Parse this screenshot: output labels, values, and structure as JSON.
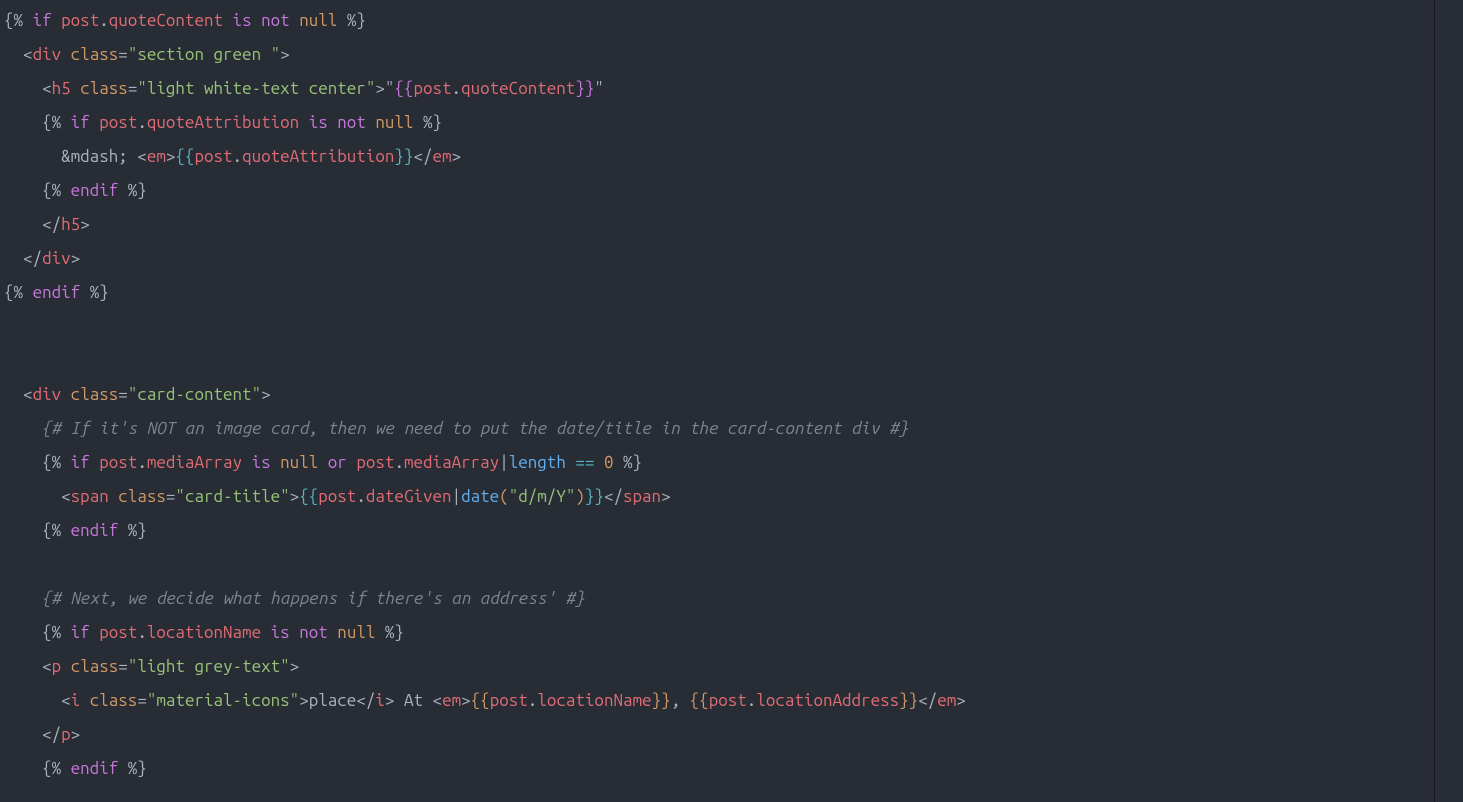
{
  "code": {
    "lines": [
      [
        {
          "t": "{% ",
          "c": "tk-delim"
        },
        {
          "t": "if",
          "c": "tk-kw"
        },
        {
          "t": " ",
          "c": "tk-delim"
        },
        {
          "t": "post",
          "c": "tk-ident"
        },
        {
          "t": ".",
          "c": "tk-punct"
        },
        {
          "t": "quoteContent",
          "c": "tk-ident"
        },
        {
          "t": " ",
          "c": "tk-delim"
        },
        {
          "t": "is",
          "c": "tk-kw"
        },
        {
          "t": " ",
          "c": "tk-delim"
        },
        {
          "t": "not",
          "c": "tk-kw"
        },
        {
          "t": " ",
          "c": "tk-delim"
        },
        {
          "t": "null",
          "c": "tk-attr"
        },
        {
          "t": " %}",
          "c": "tk-delim"
        }
      ],
      [
        {
          "t": "  ",
          "c": "tk-text"
        },
        {
          "t": "<",
          "c": "tk-punct"
        },
        {
          "t": "div",
          "c": "tk-ident"
        },
        {
          "t": " ",
          "c": "tk-text"
        },
        {
          "t": "class",
          "c": "tk-attr"
        },
        {
          "t": "=",
          "c": "tk-punct"
        },
        {
          "t": "\"section green \"",
          "c": "tk-str"
        },
        {
          "t": ">",
          "c": "tk-punct"
        }
      ],
      [
        {
          "t": "    ",
          "c": "tk-text"
        },
        {
          "t": "<",
          "c": "tk-punct"
        },
        {
          "t": "h5",
          "c": "tk-ident"
        },
        {
          "t": " ",
          "c": "tk-text"
        },
        {
          "t": "class",
          "c": "tk-attr"
        },
        {
          "t": "=",
          "c": "tk-punct"
        },
        {
          "t": "\"light white-text center\"",
          "c": "tk-str"
        },
        {
          "t": ">",
          "c": "tk-punct"
        },
        {
          "t": "\"",
          "c": "tk-text"
        },
        {
          "t": "{{",
          "c": "bracket-p"
        },
        {
          "t": "post",
          "c": "tk-ident"
        },
        {
          "t": ".",
          "c": "tk-punct"
        },
        {
          "t": "quoteContent",
          "c": "tk-ident"
        },
        {
          "t": "}}",
          "c": "bracket-p"
        },
        {
          "t": "\"",
          "c": "tk-text"
        }
      ],
      [
        {
          "t": "    {% ",
          "c": "tk-delim"
        },
        {
          "t": "if",
          "c": "tk-kw"
        },
        {
          "t": " ",
          "c": "tk-delim"
        },
        {
          "t": "post",
          "c": "tk-ident"
        },
        {
          "t": ".",
          "c": "tk-punct"
        },
        {
          "t": "quoteAttribution",
          "c": "tk-ident"
        },
        {
          "t": " ",
          "c": "tk-delim"
        },
        {
          "t": "is",
          "c": "tk-kw"
        },
        {
          "t": " ",
          "c": "tk-delim"
        },
        {
          "t": "not",
          "c": "tk-kw"
        },
        {
          "t": " ",
          "c": "tk-delim"
        },
        {
          "t": "null",
          "c": "tk-attr"
        },
        {
          "t": " %}",
          "c": "tk-delim"
        }
      ],
      [
        {
          "t": "      &mdash; ",
          "c": "tk-text"
        },
        {
          "t": "<",
          "c": "tk-punct"
        },
        {
          "t": "em",
          "c": "tk-ident"
        },
        {
          "t": ">",
          "c": "tk-punct"
        },
        {
          "t": "{{",
          "c": "bracket-b"
        },
        {
          "t": "post",
          "c": "tk-ident"
        },
        {
          "t": ".",
          "c": "tk-punct"
        },
        {
          "t": "quoteAttribution",
          "c": "tk-ident"
        },
        {
          "t": "}}",
          "c": "bracket-b"
        },
        {
          "t": "</",
          "c": "tk-punct"
        },
        {
          "t": "em",
          "c": "tk-ident"
        },
        {
          "t": ">",
          "c": "tk-punct"
        }
      ],
      [
        {
          "t": "    {% ",
          "c": "tk-delim"
        },
        {
          "t": "endif",
          "c": "tk-kw"
        },
        {
          "t": " %}",
          "c": "tk-delim"
        }
      ],
      [
        {
          "t": "    ",
          "c": "tk-text"
        },
        {
          "t": "</",
          "c": "tk-punct"
        },
        {
          "t": "h5",
          "c": "tk-ident"
        },
        {
          "t": ">",
          "c": "tk-punct"
        }
      ],
      [
        {
          "t": "  ",
          "c": "tk-text"
        },
        {
          "t": "</",
          "c": "tk-punct"
        },
        {
          "t": "div",
          "c": "tk-ident"
        },
        {
          "t": ">",
          "c": "tk-punct"
        }
      ],
      [
        {
          "t": "{% ",
          "c": "tk-delim"
        },
        {
          "t": "endif",
          "c": "tk-kw"
        },
        {
          "t": " %}",
          "c": "tk-delim"
        }
      ],
      [
        {
          "t": "",
          "c": "tk-text"
        }
      ],
      [
        {
          "t": "",
          "c": "tk-text"
        }
      ],
      [
        {
          "t": "  ",
          "c": "tk-text"
        },
        {
          "t": "<",
          "c": "tk-punct"
        },
        {
          "t": "div",
          "c": "tk-ident"
        },
        {
          "t": " ",
          "c": "tk-text"
        },
        {
          "t": "class",
          "c": "tk-attr"
        },
        {
          "t": "=",
          "c": "tk-punct"
        },
        {
          "t": "\"card-content\"",
          "c": "tk-str"
        },
        {
          "t": ">",
          "c": "tk-punct"
        }
      ],
      [
        {
          "t": "    ",
          "c": "tk-text"
        },
        {
          "t": "{# If it's NOT an image card, then we need to put the date/title in the card-content div #}",
          "c": "tk-comment"
        }
      ],
      [
        {
          "t": "    {% ",
          "c": "tk-delim"
        },
        {
          "t": "if",
          "c": "tk-kw"
        },
        {
          "t": " ",
          "c": "tk-delim"
        },
        {
          "t": "post",
          "c": "tk-ident"
        },
        {
          "t": ".",
          "c": "tk-punct"
        },
        {
          "t": "mediaArray",
          "c": "tk-ident"
        },
        {
          "t": " ",
          "c": "tk-delim"
        },
        {
          "t": "is",
          "c": "tk-kw"
        },
        {
          "t": " ",
          "c": "tk-delim"
        },
        {
          "t": "null",
          "c": "tk-attr"
        },
        {
          "t": " ",
          "c": "tk-delim"
        },
        {
          "t": "or",
          "c": "tk-kw"
        },
        {
          "t": " ",
          "c": "tk-delim"
        },
        {
          "t": "post",
          "c": "tk-ident"
        },
        {
          "t": ".",
          "c": "tk-punct"
        },
        {
          "t": "mediaArray",
          "c": "tk-ident"
        },
        {
          "t": "|",
          "c": "tk-punct"
        },
        {
          "t": "length",
          "c": "tk-func"
        },
        {
          "t": " ",
          "c": "tk-delim"
        },
        {
          "t": "==",
          "c": "tk-op"
        },
        {
          "t": " ",
          "c": "tk-delim"
        },
        {
          "t": "0",
          "c": "tk-attr"
        },
        {
          "t": " %}",
          "c": "tk-delim"
        }
      ],
      [
        {
          "t": "      ",
          "c": "tk-text"
        },
        {
          "t": "<",
          "c": "tk-punct"
        },
        {
          "t": "span",
          "c": "tk-ident"
        },
        {
          "t": " ",
          "c": "tk-text"
        },
        {
          "t": "class",
          "c": "tk-attr"
        },
        {
          "t": "=",
          "c": "tk-punct"
        },
        {
          "t": "\"card-title\"",
          "c": "tk-str"
        },
        {
          "t": ">",
          "c": "tk-punct"
        },
        {
          "t": "{{",
          "c": "bracket-b"
        },
        {
          "t": "post",
          "c": "tk-ident"
        },
        {
          "t": ".",
          "c": "tk-punct"
        },
        {
          "t": "dateGiven",
          "c": "tk-ident"
        },
        {
          "t": "|",
          "c": "tk-punct"
        },
        {
          "t": "date",
          "c": "tk-func"
        },
        {
          "t": "(",
          "c": "bracket-y"
        },
        {
          "t": "\"d/m/Y\"",
          "c": "tk-str"
        },
        {
          "t": ")",
          "c": "bracket-y"
        },
        {
          "t": "}}",
          "c": "bracket-b"
        },
        {
          "t": "</",
          "c": "tk-punct"
        },
        {
          "t": "span",
          "c": "tk-ident"
        },
        {
          "t": ">",
          "c": "tk-punct"
        }
      ],
      [
        {
          "t": "    {% ",
          "c": "tk-delim"
        },
        {
          "t": "endif",
          "c": "tk-kw"
        },
        {
          "t": " %}",
          "c": "tk-delim"
        }
      ],
      [
        {
          "t": "",
          "c": "tk-text"
        }
      ],
      [
        {
          "t": "    ",
          "c": "tk-text"
        },
        {
          "t": "{# Next, we decide what happens if there's an address' #}",
          "c": "tk-comment"
        }
      ],
      [
        {
          "t": "    {% ",
          "c": "tk-delim"
        },
        {
          "t": "if",
          "c": "tk-kw"
        },
        {
          "t": " ",
          "c": "tk-delim"
        },
        {
          "t": "post",
          "c": "tk-ident"
        },
        {
          "t": ".",
          "c": "tk-punct"
        },
        {
          "t": "locationName",
          "c": "tk-ident"
        },
        {
          "t": " ",
          "c": "tk-delim"
        },
        {
          "t": "is",
          "c": "tk-kw"
        },
        {
          "t": " ",
          "c": "tk-delim"
        },
        {
          "t": "not",
          "c": "tk-kw"
        },
        {
          "t": " ",
          "c": "tk-delim"
        },
        {
          "t": "null",
          "c": "tk-attr"
        },
        {
          "t": " %}",
          "c": "tk-delim"
        }
      ],
      [
        {
          "t": "    ",
          "c": "tk-text"
        },
        {
          "t": "<",
          "c": "tk-punct"
        },
        {
          "t": "p",
          "c": "tk-ident"
        },
        {
          "t": " ",
          "c": "tk-text"
        },
        {
          "t": "class",
          "c": "tk-attr"
        },
        {
          "t": "=",
          "c": "tk-punct"
        },
        {
          "t": "\"light grey-text\"",
          "c": "tk-str"
        },
        {
          "t": ">",
          "c": "tk-punct"
        }
      ],
      [
        {
          "t": "      ",
          "c": "tk-text"
        },
        {
          "t": "<",
          "c": "tk-punct"
        },
        {
          "t": "i",
          "c": "tk-ident"
        },
        {
          "t": " ",
          "c": "tk-text"
        },
        {
          "t": "class",
          "c": "tk-attr"
        },
        {
          "t": "=",
          "c": "tk-punct"
        },
        {
          "t": "\"material-icons\"",
          "c": "tk-str"
        },
        {
          "t": ">",
          "c": "tk-punct"
        },
        {
          "t": "place",
          "c": "tk-text"
        },
        {
          "t": "</",
          "c": "tk-punct"
        },
        {
          "t": "i",
          "c": "tk-ident"
        },
        {
          "t": ">",
          "c": "tk-punct"
        },
        {
          "t": " At ",
          "c": "tk-text"
        },
        {
          "t": "<",
          "c": "tk-punct"
        },
        {
          "t": "em",
          "c": "tk-ident"
        },
        {
          "t": ">",
          "c": "tk-punct"
        },
        {
          "t": "{{",
          "c": "bracket-y"
        },
        {
          "t": "post",
          "c": "tk-ident"
        },
        {
          "t": ".",
          "c": "tk-punct"
        },
        {
          "t": "locationName",
          "c": "tk-ident"
        },
        {
          "t": "}}",
          "c": "bracket-y"
        },
        {
          "t": ", ",
          "c": "tk-text"
        },
        {
          "t": "{{",
          "c": "bracket-y"
        },
        {
          "t": "post",
          "c": "tk-ident"
        },
        {
          "t": ".",
          "c": "tk-punct"
        },
        {
          "t": "locationAddress",
          "c": "tk-ident"
        },
        {
          "t": "}}",
          "c": "bracket-y"
        },
        {
          "t": "</",
          "c": "tk-punct"
        },
        {
          "t": "em",
          "c": "tk-ident"
        },
        {
          "t": ">",
          "c": "tk-punct"
        }
      ],
      [
        {
          "t": "    ",
          "c": "tk-text"
        },
        {
          "t": "</",
          "c": "tk-punct"
        },
        {
          "t": "p",
          "c": "tk-ident"
        },
        {
          "t": ">",
          "c": "tk-punct"
        }
      ],
      [
        {
          "t": "    {% ",
          "c": "tk-delim"
        },
        {
          "t": "endif",
          "c": "tk-kw"
        },
        {
          "t": " %}",
          "c": "tk-delim"
        }
      ]
    ]
  }
}
